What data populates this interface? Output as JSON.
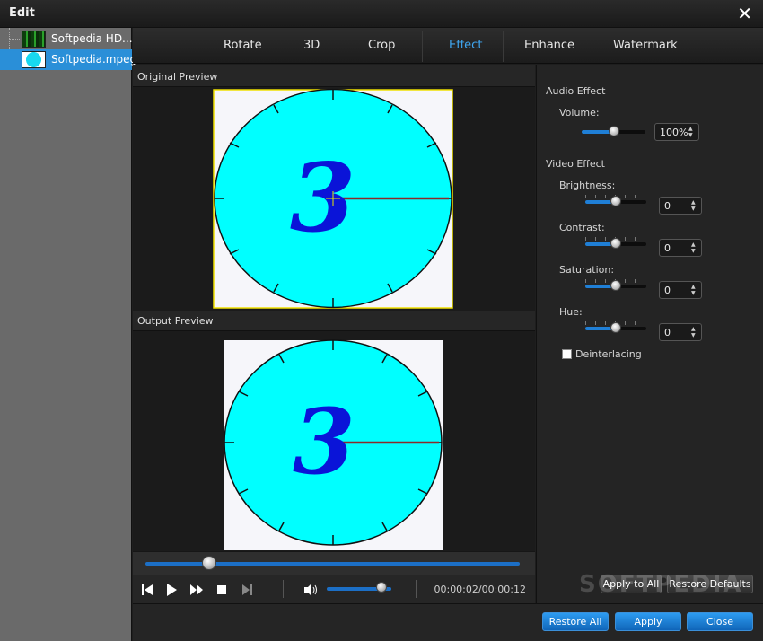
{
  "window": {
    "title": "Edit",
    "close_glyph": "✕"
  },
  "files": [
    {
      "name": "Softpedia HD....",
      "thumb_color": "#1a6a1a"
    },
    {
      "name": "Softpedia.mpeg",
      "thumb_color": "#18d8f0"
    }
  ],
  "tabs": [
    {
      "label": "Rotate"
    },
    {
      "label": "3D"
    },
    {
      "label": "Crop"
    },
    {
      "label": "Effect",
      "active": true
    },
    {
      "label": "Enhance"
    },
    {
      "label": "Watermark"
    }
  ],
  "preview": {
    "original_label": "Original Preview",
    "output_label": "Output Preview",
    "clock_digit": "3"
  },
  "playback": {
    "timecode": "00:00:02/00:00:12",
    "seek_fraction": 0.17,
    "volume_fraction": 0.85
  },
  "audio": {
    "section": "Audio Effect",
    "volume_label": "Volume:",
    "volume_value": "100%",
    "volume_fraction": 0.5
  },
  "video": {
    "section": "Video Effect",
    "brightness_label": "Brightness:",
    "brightness_value": "0",
    "contrast_label": "Contrast:",
    "contrast_value": "0",
    "saturation_label": "Saturation:",
    "saturation_value": "0",
    "hue_label": "Hue:",
    "hue_value": "0",
    "slider_fraction": 0.5,
    "deinterlacing_label": "Deinterlacing"
  },
  "buttons": {
    "apply_to_all": "Apply to All",
    "restore_defaults": "Restore Defaults",
    "restore_all": "Restore All",
    "apply": "Apply",
    "close": "Close"
  },
  "watermark_text": "SOFTPEDIA",
  "colors": {
    "accent": "#3fa6f0",
    "clock_face": "#00ffff",
    "digit": "#0a14d8",
    "hand": "#8a2b2b"
  }
}
